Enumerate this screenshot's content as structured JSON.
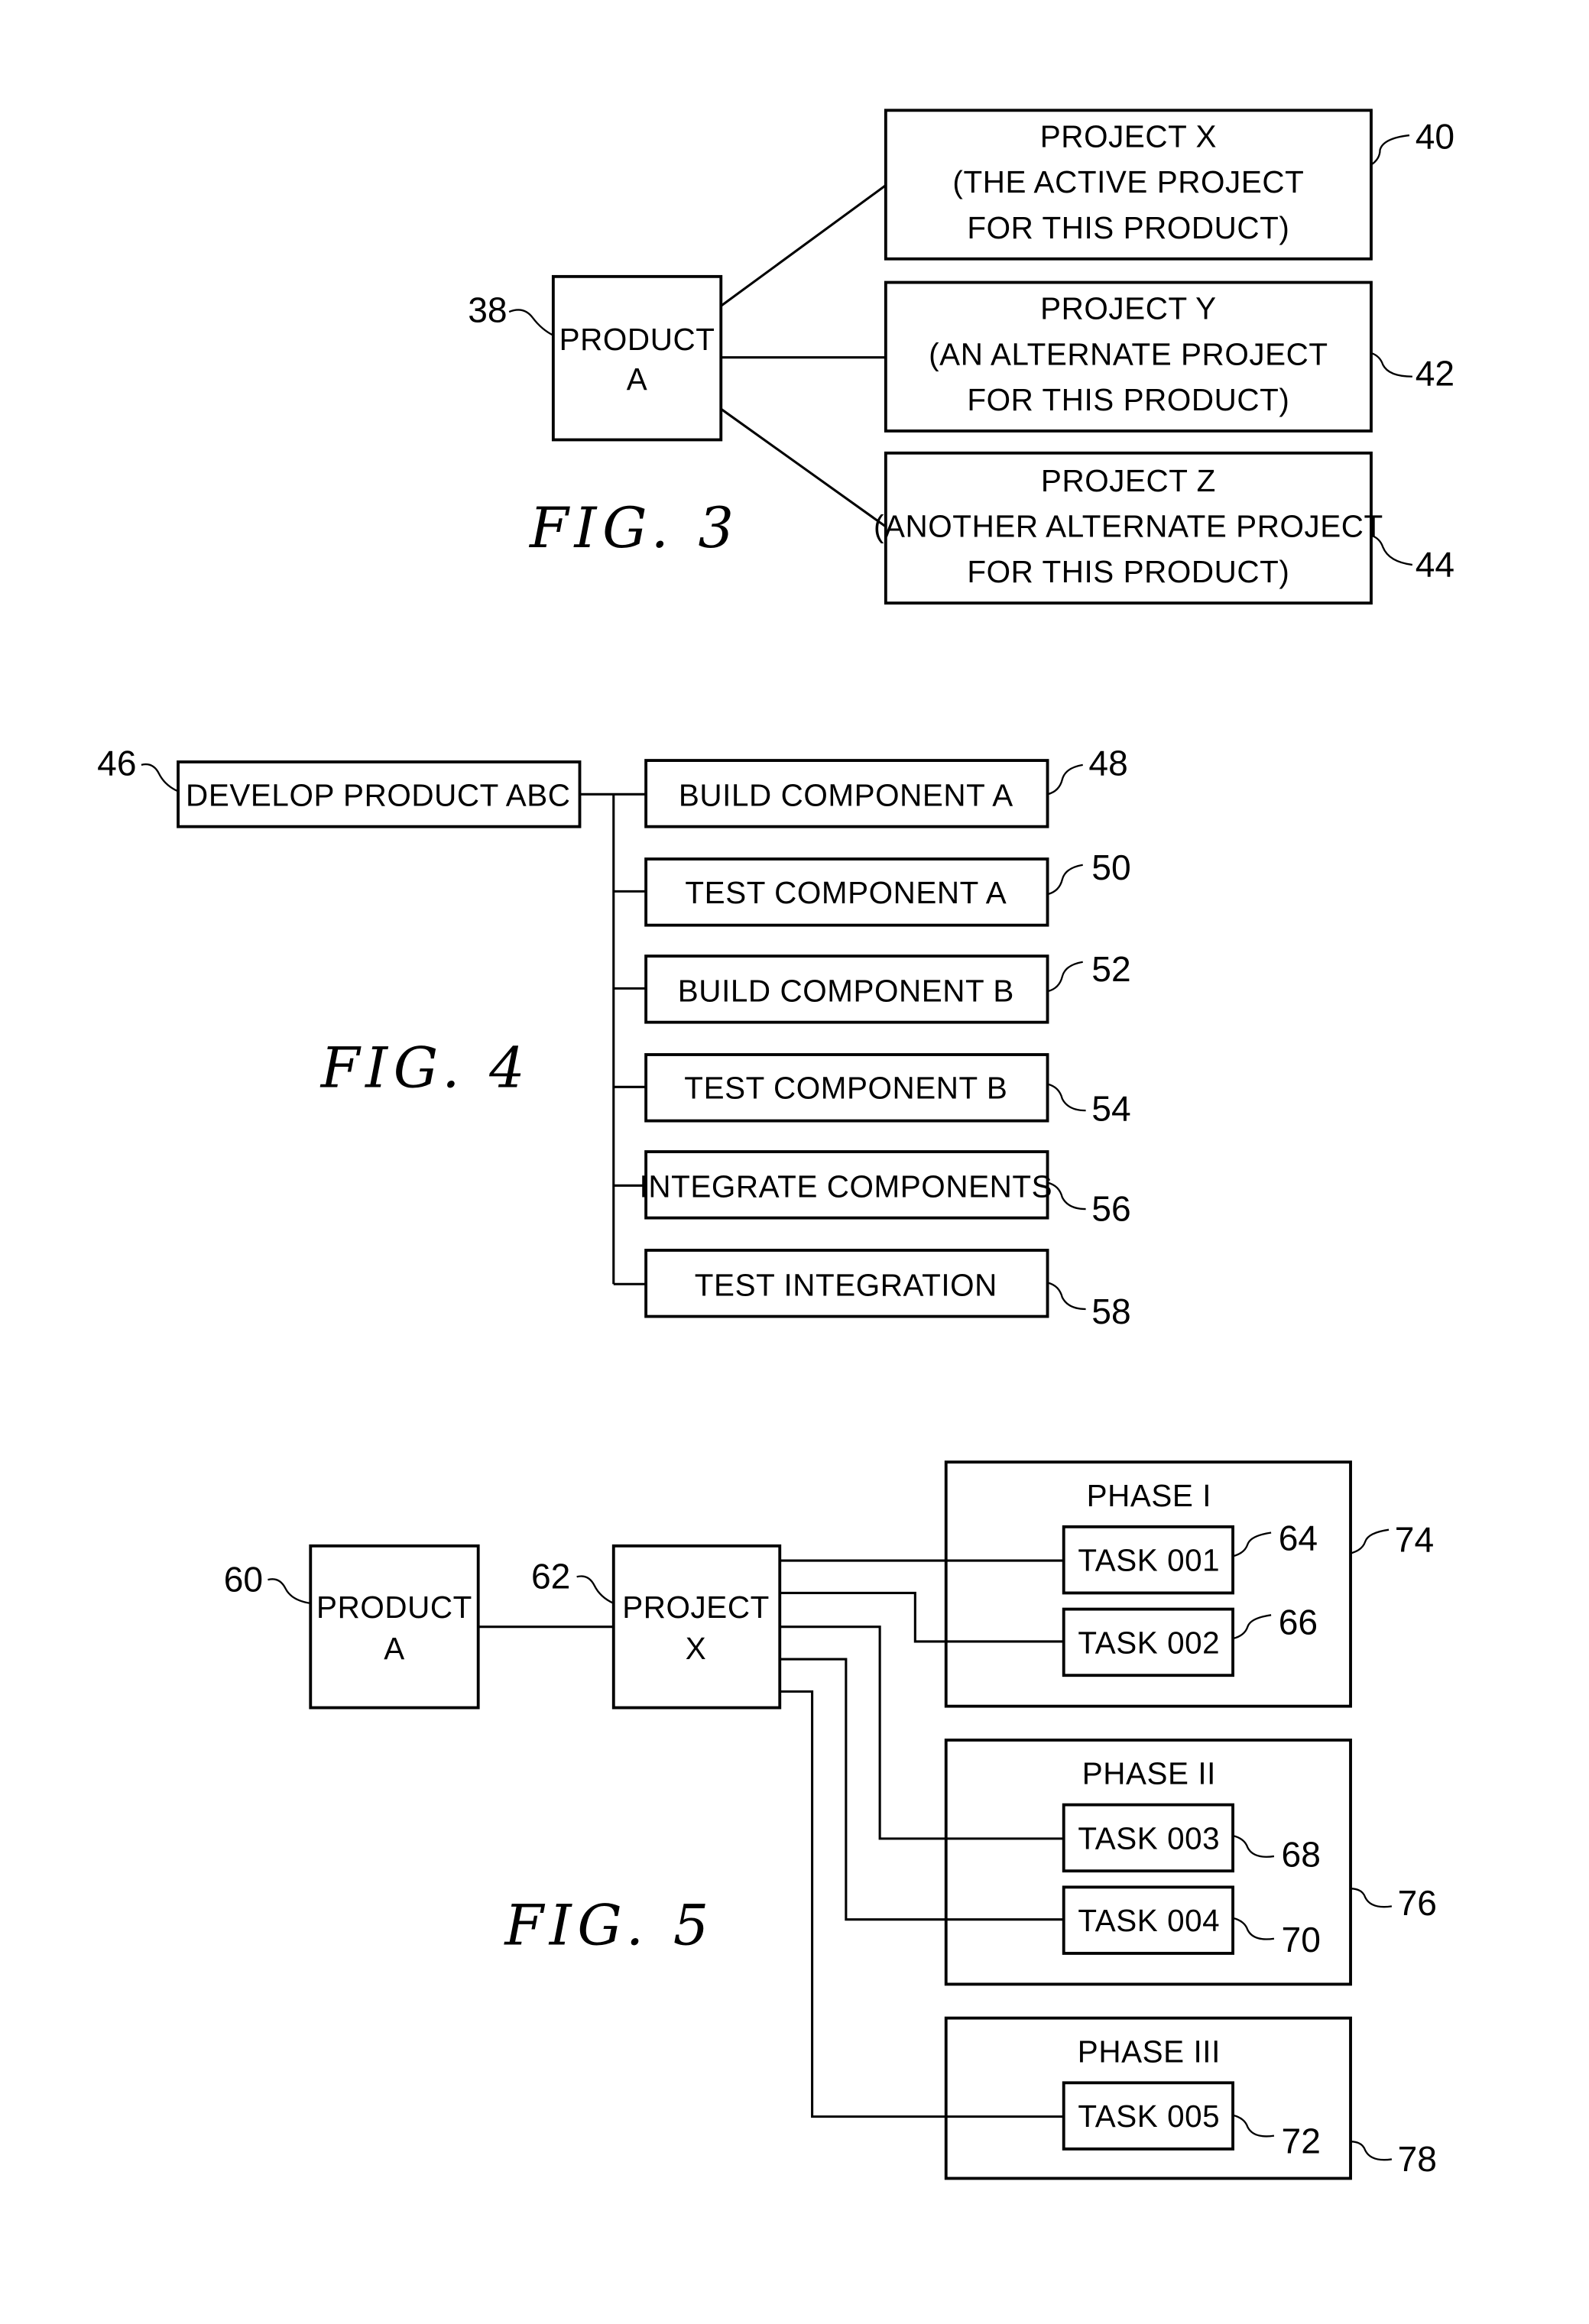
{
  "fig3": {
    "caption": "FIG. 3",
    "product": {
      "ref": "38",
      "lines": [
        "PRODUCT",
        "A"
      ]
    },
    "projects": [
      {
        "ref": "40",
        "lines": [
          "PROJECT X",
          "(THE ACTIVE PROJECT",
          "FOR THIS PRODUCT)"
        ]
      },
      {
        "ref": "42",
        "lines": [
          "PROJECT Y",
          "(AN ALTERNATE PROJECT",
          "FOR THIS PRODUCT)"
        ]
      },
      {
        "ref": "44",
        "lines": [
          "PROJECT Z",
          "(ANOTHER ALTERNATE PROJECT",
          "FOR THIS PRODUCT)"
        ]
      }
    ]
  },
  "fig4": {
    "caption": "FIG. 4",
    "root": {
      "ref": "46",
      "label": "DEVELOP PRODUCT ABC"
    },
    "tasks": [
      {
        "ref": "48",
        "label": "BUILD COMPONENT A"
      },
      {
        "ref": "50",
        "label": "TEST COMPONENT A"
      },
      {
        "ref": "52",
        "label": "BUILD COMPONENT B"
      },
      {
        "ref": "54",
        "label": "TEST COMPONENT B"
      },
      {
        "ref": "56",
        "label": "INTEGRATE COMPONENTS"
      },
      {
        "ref": "58",
        "label": "TEST INTEGRATION"
      }
    ]
  },
  "fig5": {
    "caption": "FIG. 5",
    "product": {
      "ref": "60",
      "lines": [
        "PRODUCT",
        "A"
      ]
    },
    "project": {
      "ref": "62",
      "lines": [
        "PROJECT",
        "X"
      ]
    },
    "phases": [
      {
        "ref": "74",
        "label": "PHASE I",
        "tasks": [
          {
            "ref": "64",
            "label": "TASK 001"
          },
          {
            "ref": "66",
            "label": "TASK 002"
          }
        ]
      },
      {
        "ref": "76",
        "label": "PHASE II",
        "tasks": [
          {
            "ref": "68",
            "label": "TASK 003"
          },
          {
            "ref": "70",
            "label": "TASK 004"
          }
        ]
      },
      {
        "ref": "78",
        "label": "PHASE III",
        "tasks": [
          {
            "ref": "72",
            "label": "TASK 005"
          }
        ]
      }
    ]
  }
}
